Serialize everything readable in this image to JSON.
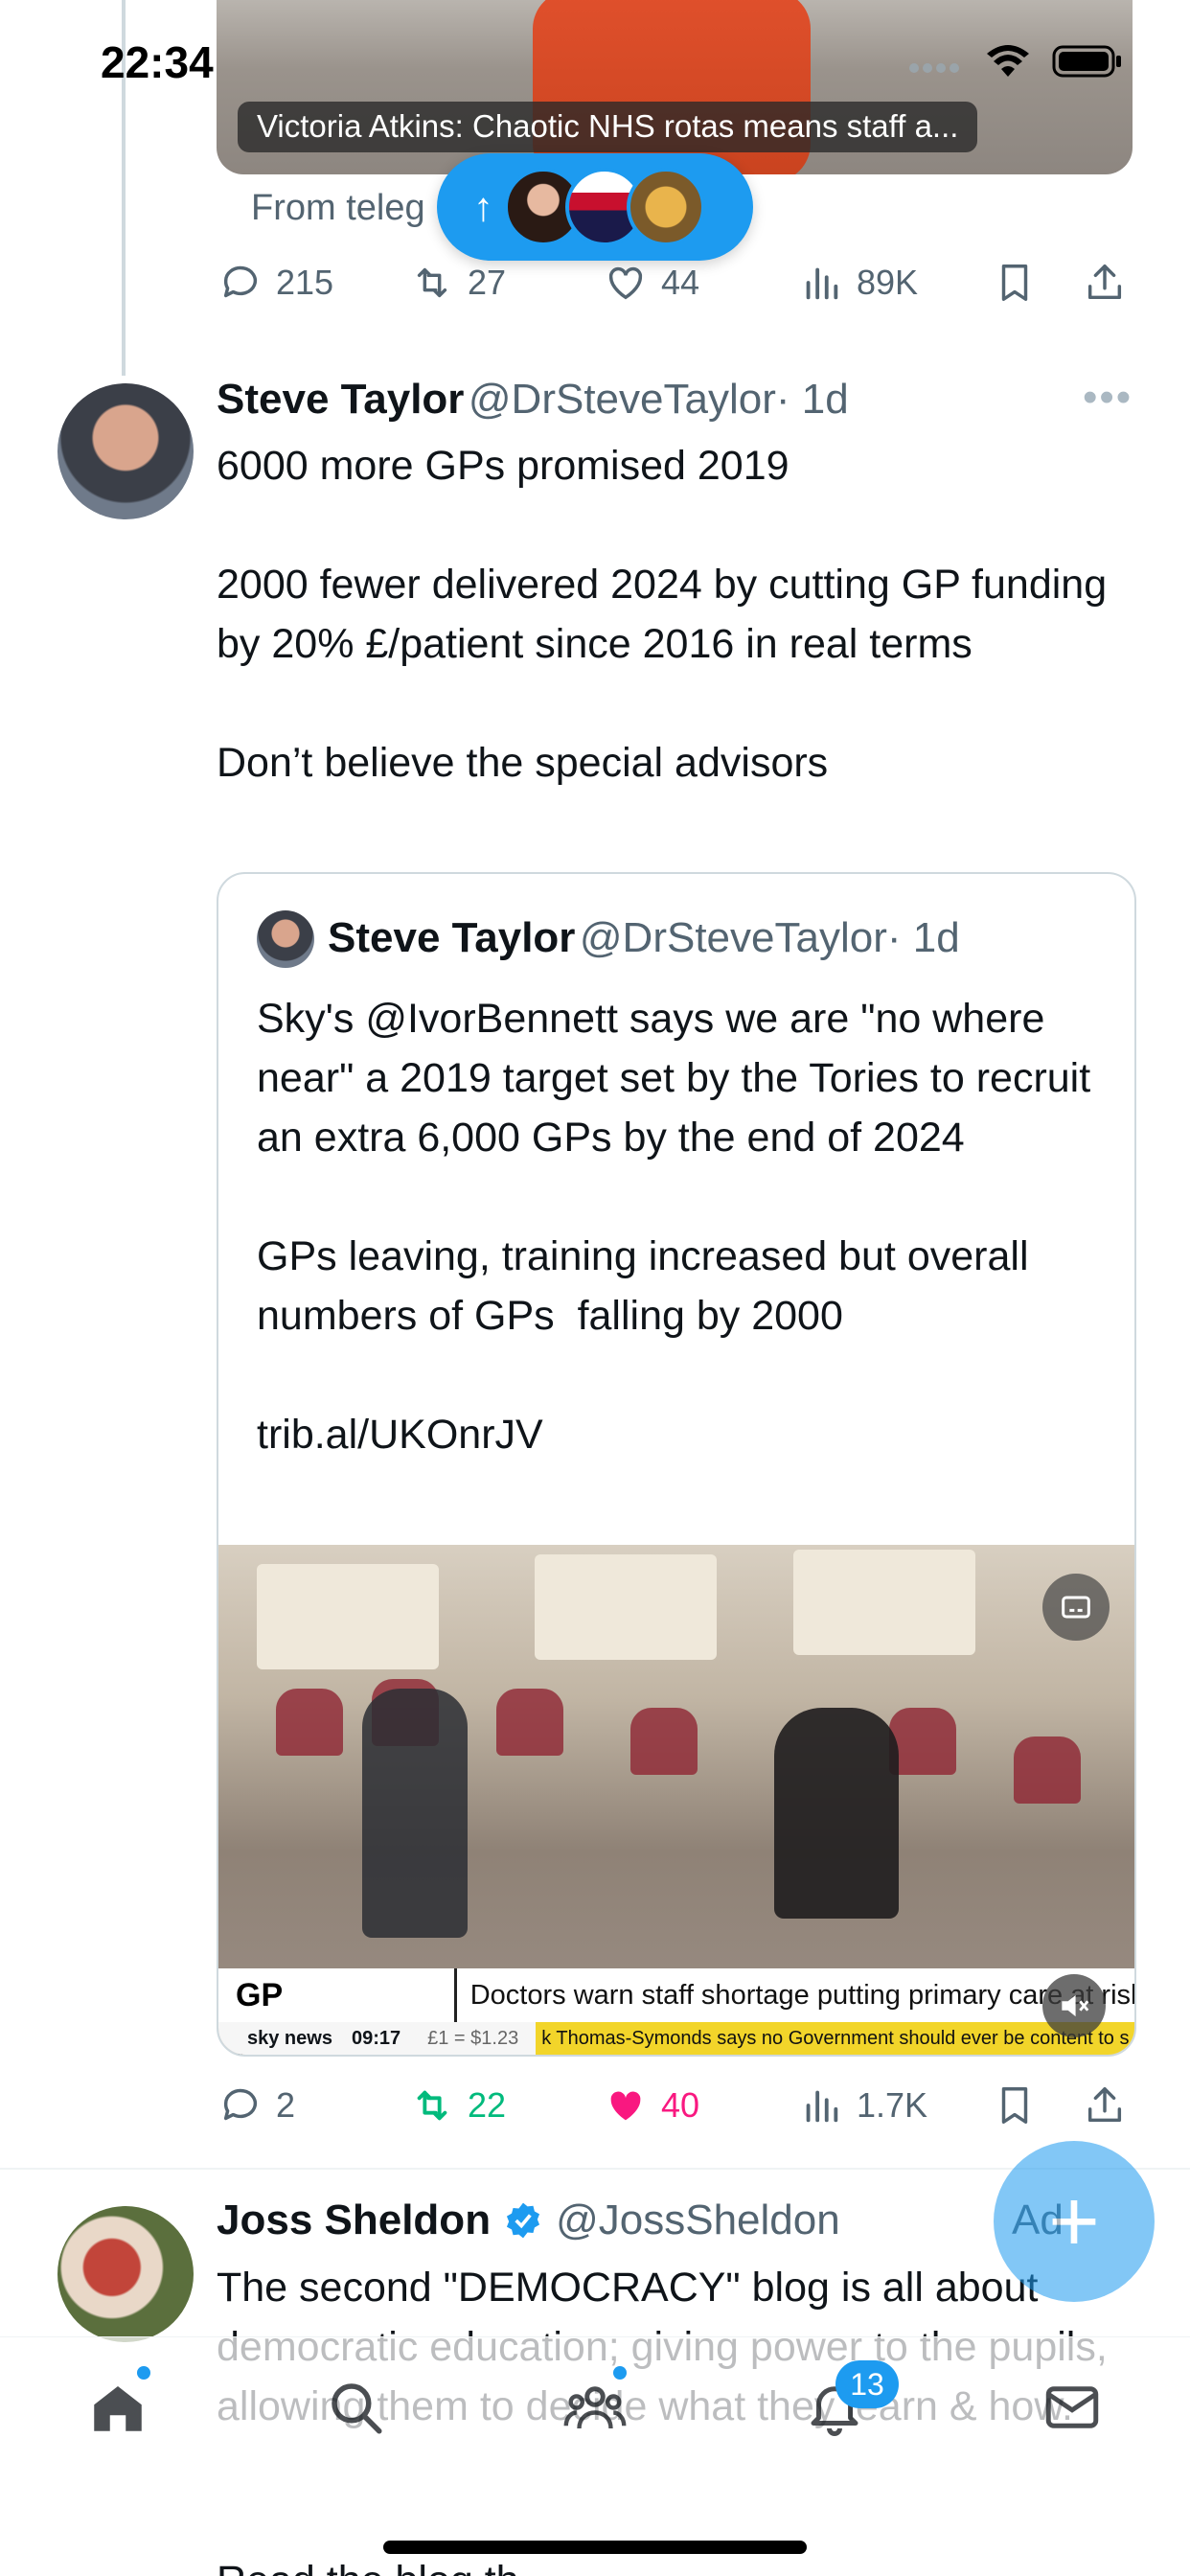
{
  "status_bar": {
    "time": "22:34"
  },
  "top_tweet": {
    "media_caption": "Victoria Atkins: Chaotic NHS rotas means staff a...",
    "from_line": "From teleg",
    "actions": {
      "replies": "215",
      "reposts": "27",
      "likes": "44",
      "views": "89K"
    }
  },
  "new_posts_pill": {
    "icon": "arrow-up-icon"
  },
  "tweet_main": {
    "author_name": "Steve Taylor",
    "author_handle": "@DrSteveTaylor",
    "time": "· 1d",
    "text": "6000 more GPs promised 2019\n\n2000 fewer delivered 2024 by cutting GP funding by 20% £/patient since 2016 in real terms\n\nDon’t believe the special advisors",
    "quote": {
      "author_name": "Steve Taylor",
      "author_handle": "@DrSteveTaylor",
      "time": "· 1d",
      "text": "Sky's @IvorBennett says we are \"no where near\" a 2019 target set by the Tories to recruit an extra 6,000 GPs by the end of 2024\n\nGPs leaving, training increased but overall numbers of GPs  falling by 2000\n\ntrib.al/UKOnrJV",
      "video": {
        "ticker_tag": "GP PRESSURES",
        "ticker_text": "Doctors warn staff shortage putting primary care at risk",
        "channel": "sky news",
        "clock": "09:17",
        "fx": "£1 = $1.23",
        "crawl": "k Thomas-Symonds says no Government should ever be content to s"
      }
    },
    "actions": {
      "replies": "2",
      "reposts": "22",
      "likes": "40",
      "views": "1.7K"
    },
    "colors": {
      "repost_active": "#00ba7c",
      "like_active": "#f91880"
    }
  },
  "tweet_next": {
    "author_name": "Joss Sheldon",
    "author_handle": "@JossSheldon",
    "verified": true,
    "ad_label": "Ad",
    "text": "The second \"DEMOCRACY\" blog is all about democratic education; giving power to the pupils, allowing them to decide what they learn & how.",
    "text_tail": "Read the blog th..."
  },
  "bottom_nav": {
    "items": [
      "home-icon",
      "search-icon",
      "communities-icon",
      "notifications-icon",
      "messages-icon"
    ],
    "notifications_badge": "13"
  },
  "fab": {
    "icon": "plus-icon"
  },
  "accent": "#1d9bf0"
}
